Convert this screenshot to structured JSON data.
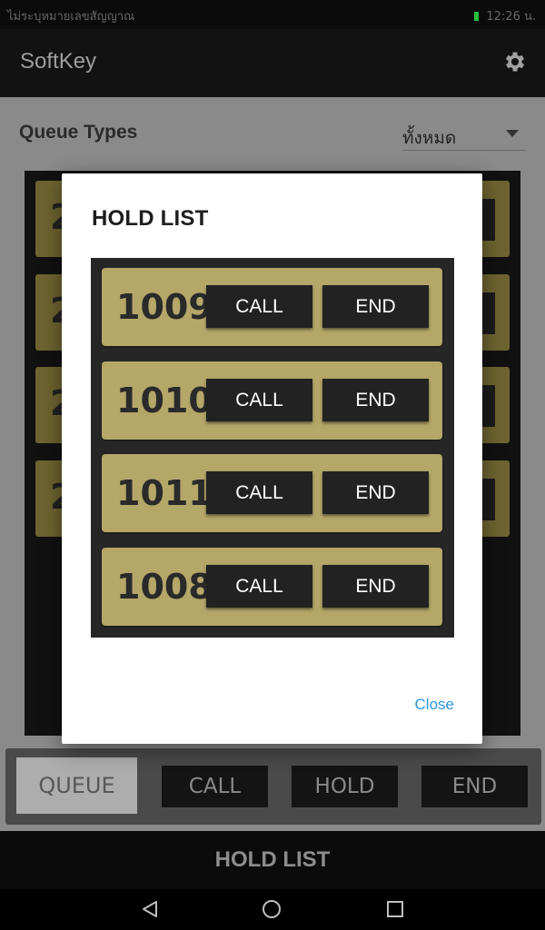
{
  "status_bar": {
    "left_text": "ไม่ระบุหมายเลขสัญญาณ",
    "time": "12:26 น."
  },
  "app_bar": {
    "title": "SoftKey",
    "settings_icon": "gear-icon"
  },
  "queue_filter": {
    "label": "Queue Types",
    "selected": "ทั้งหมด"
  },
  "background_queue": {
    "items": [
      "2",
      "2",
      "2",
      "2"
    ]
  },
  "bottom_toolbar": {
    "queue_label": "QUEUE",
    "call_label": "CALL",
    "hold_label": "HOLD",
    "end_label": "END"
  },
  "hold_list_bar": {
    "label": "HOLD LIST"
  },
  "dialog": {
    "title": "HOLD LIST",
    "items": [
      {
        "number": "1009",
        "call_label": "CALL",
        "end_label": "END"
      },
      {
        "number": "1010",
        "call_label": "CALL",
        "end_label": "END"
      },
      {
        "number": "1011",
        "call_label": "CALL",
        "end_label": "END"
      },
      {
        "number": "1008",
        "call_label": "CALL",
        "end_label": "END"
      }
    ],
    "close_label": "Close"
  },
  "colors": {
    "card_gold": "#b5a768",
    "button_dark": "#222222",
    "link_blue": "#2d95e0",
    "battery_green": "#1fc03a"
  }
}
